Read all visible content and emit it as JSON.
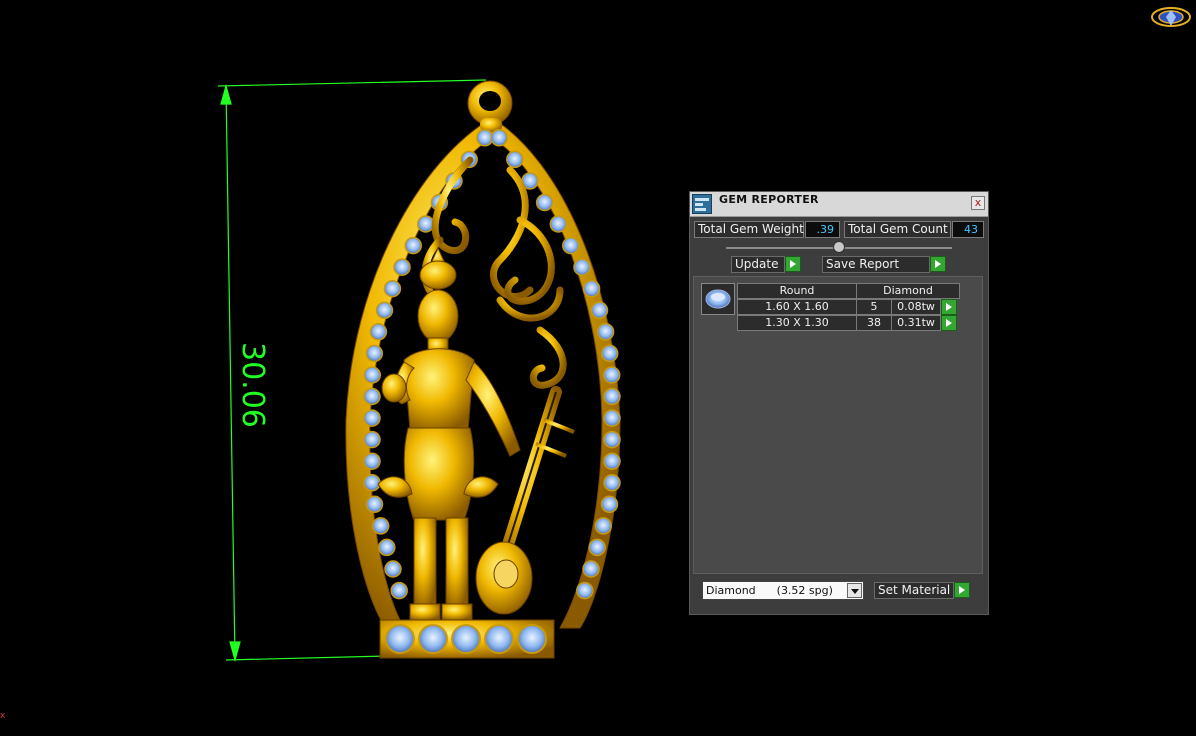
{
  "viewport": {
    "dimension_value": "30.06",
    "corner_mark": "x",
    "logo_icon": "gem-logo-icon",
    "dimension_color": "#22ff22",
    "gold_color": "#f0b800",
    "gem_color": "#8fb8f0"
  },
  "panel": {
    "title": "GEM REPORTER",
    "title_icon": "gem-reporter-app-icon",
    "close_label": "x",
    "total_weight_label": "Total Gem Weight",
    "total_weight_value": ".39",
    "total_count_label": "Total Gem Count",
    "total_count_value": "43",
    "update_label": "Update",
    "save_report_label": "Save Report",
    "gem_table": {
      "shape_header": "Round",
      "material_header": "Diamond",
      "rows": [
        {
          "size": "1.60 X 1.60",
          "count": "5",
          "weight": "0.08tw"
        },
        {
          "size": "1.30 X 1.30",
          "count": "38",
          "weight": "0.31tw"
        }
      ]
    },
    "material_select_value": "Diamond      (3.52 spg)",
    "set_material_label": "Set Material"
  }
}
